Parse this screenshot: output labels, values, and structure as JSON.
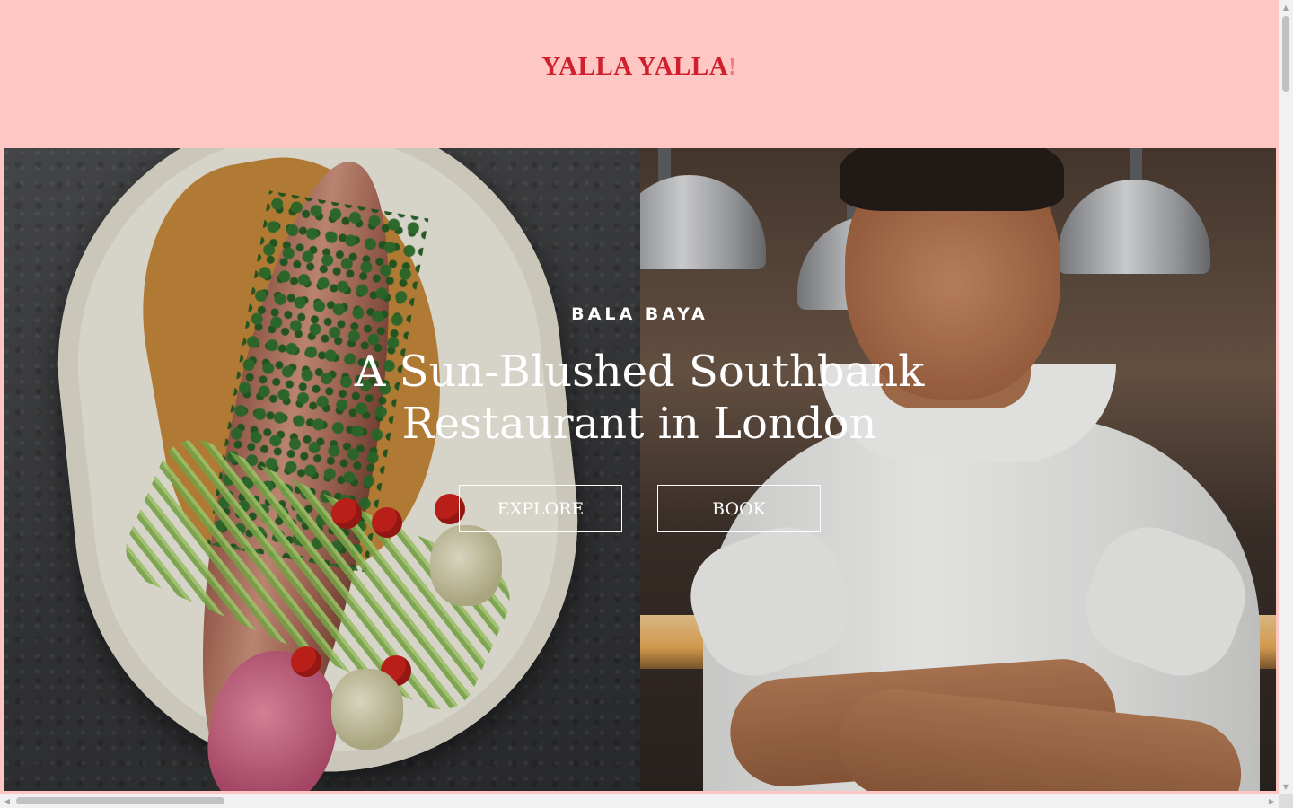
{
  "header": {
    "logo_text": "YALLA YALLA",
    "logo_mark": "!"
  },
  "hero": {
    "eyebrow": "BALA BAYA",
    "title": "A Sun-Blushed Southbank Restaurant in London",
    "buttons": {
      "explore_label": "EXPLORE",
      "book_label": "BOOK"
    }
  },
  "colors": {
    "page_background": "#ffc7c3",
    "brand_red": "#d0202e",
    "hero_text": "#ffffff"
  },
  "scrollbars": {
    "up": "▲",
    "down": "▼",
    "left": "◀",
    "right": "▶"
  }
}
